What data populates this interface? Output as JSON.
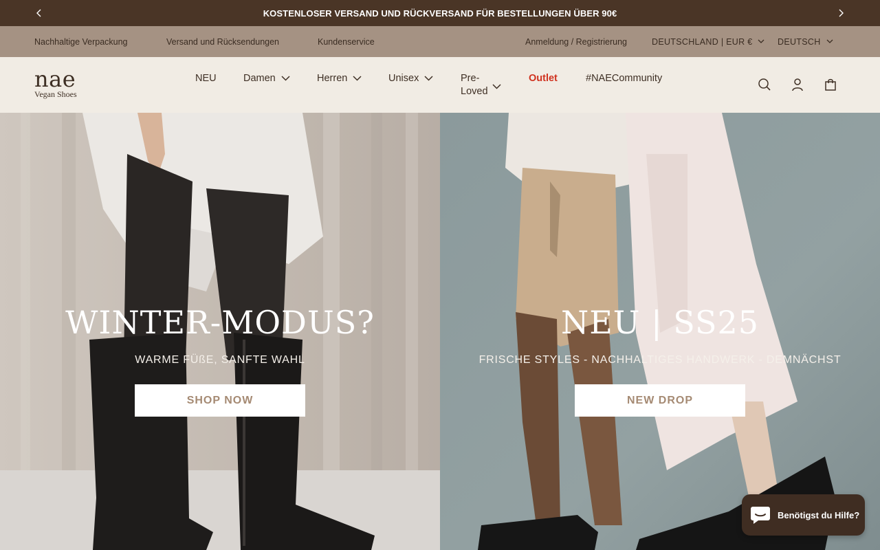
{
  "announcement": {
    "text": "KOSTENLOSER VERSAND UND RÜCKVERSAND FÜR BESTELLUNGEN ÜBER 90€",
    "prev_icon": "chevron-left-icon",
    "next_icon": "chevron-right-icon"
  },
  "utility": {
    "links": [
      "Nachhaltige Verpackung",
      "Versand und Rücksendungen",
      "Kundenservice"
    ],
    "login": "Anmeldung / Registrierung",
    "country": "DEUTSCHLAND | EUR €",
    "language": "DEUTSCH"
  },
  "header": {
    "logo_word": "nae",
    "logo_sub": "Vegan Shoes",
    "nav": {
      "neu": "NEU",
      "damen": "Damen",
      "herren": "Herren",
      "unisex": "Unisex",
      "preloved": "Pre-Loved",
      "outlet": "Outlet",
      "community": "#NAECommunity"
    },
    "icons": [
      "search-icon",
      "account-icon",
      "cart-icon"
    ]
  },
  "hero": {
    "left": {
      "title": "WINTER-MODUS?",
      "subtitle": "WARME FÜßE, SANFTE WAHL",
      "cta": "SHOP NOW"
    },
    "right": {
      "title": "NEU | SS25",
      "subtitle": "FRISCHE STYLES - NACHHALTIGES HANDWERK - DEMNÄCHST",
      "cta": "NEW DROP"
    }
  },
  "chat": {
    "label": "Benötigst du Hilfe?",
    "icon": "chat-bubble-icon"
  },
  "colors": {
    "announcement_bg": "#4a3526",
    "utility_bg": "#a59283",
    "header_bg": "#f1ece4",
    "outlet_red": "#d0321f",
    "cta_text": "#a58a73",
    "chat_bg": "#3f2d22"
  }
}
